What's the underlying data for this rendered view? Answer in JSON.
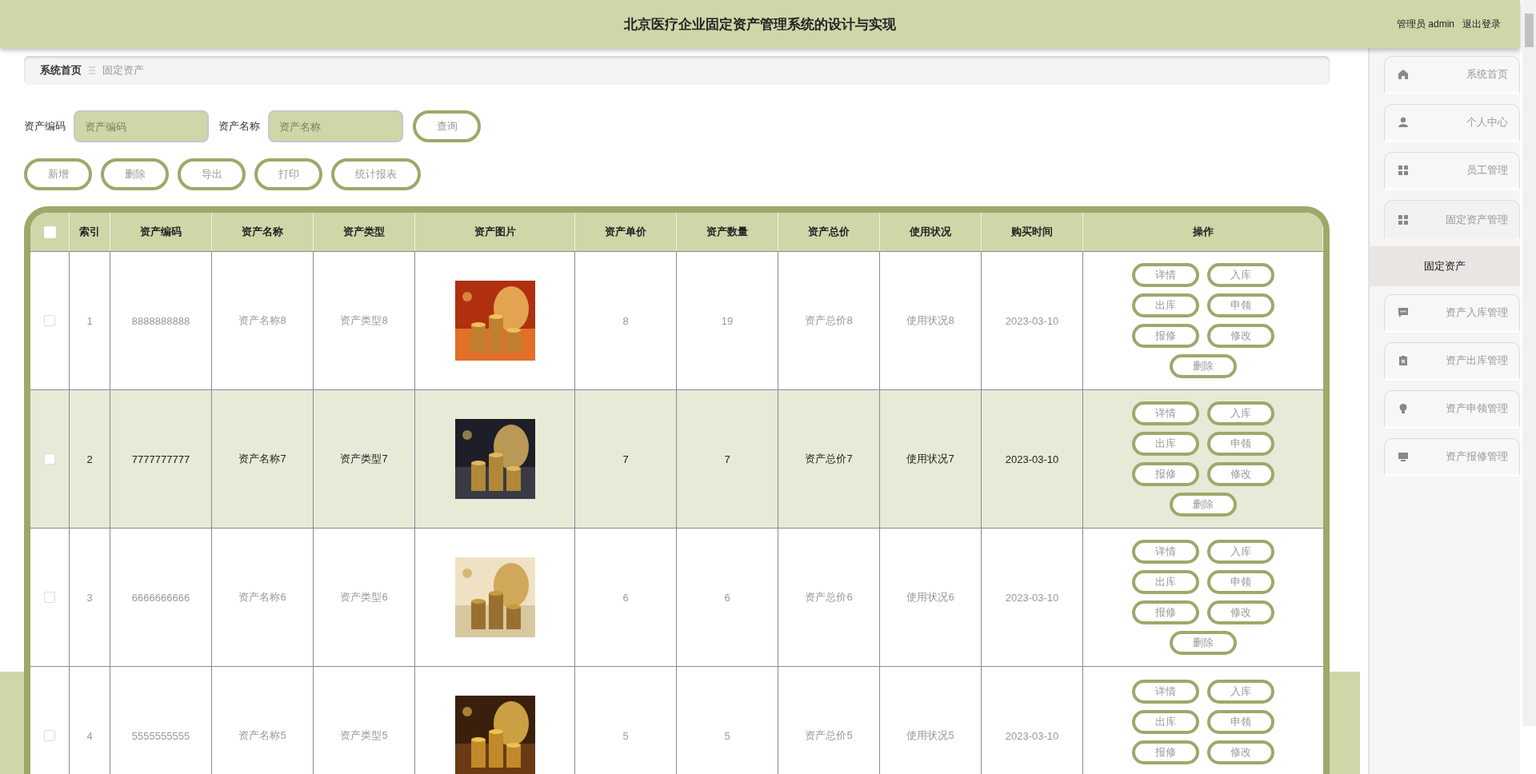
{
  "header": {
    "title": "北京医疗企业固定资产管理系统的设计与实现",
    "user": "管理员 admin",
    "logout": "退出登录"
  },
  "sidebar": {
    "items": [
      {
        "label": "系统首页",
        "selected": false
      },
      {
        "label": "个人中心",
        "selected": false
      },
      {
        "label": "员工管理",
        "selected": false
      },
      {
        "label": "固定资产管理",
        "selected": false,
        "expanded": true,
        "children": [
          {
            "label": "固定资产",
            "selected": true
          }
        ]
      },
      {
        "label": "资产入库管理",
        "selected": false
      },
      {
        "label": "资产出库管理",
        "selected": false
      },
      {
        "label": "资产申领管理",
        "selected": false
      },
      {
        "label": "资产报修管理",
        "selected": false
      }
    ]
  },
  "breadcrumb": [
    "系统首页",
    "固定资产"
  ],
  "search": {
    "fields": [
      {
        "label": "资产编码",
        "placeholder": "资产编码"
      },
      {
        "label": "资产名称",
        "placeholder": "资产名称"
      }
    ],
    "button": "查询"
  },
  "toolbar": [
    "新增",
    "删除",
    "导出",
    "打印",
    "统计报表"
  ],
  "table": {
    "all_checked": false,
    "columns": [
      "索引",
      "资产编码",
      "资产名称",
      "资产类型",
      "资产图片",
      "资产单价",
      "资产数量",
      "资产总价",
      "使用状况",
      "购买时间",
      "操作"
    ],
    "rows": [
      {
        "checked": false,
        "hover": false,
        "index": "1",
        "code": "8888888888",
        "name": "资产名称8",
        "type": "资产类型8",
        "picture": {
          "kind": "picture"
        },
        "price": "8",
        "quantity": "19",
        "total": "资产总价8",
        "status": "使用状况8",
        "date": "2023-03-10",
        "actions": [
          "详情",
          "入库",
          "出库",
          "申领",
          "报修",
          "修改",
          "删除"
        ]
      },
      {
        "checked": false,
        "hover": true,
        "index": "2",
        "code": "7777777777",
        "name": "资产名称7",
        "type": "资产类型7",
        "picture": {
          "kind": "picture"
        },
        "price": "7",
        "quantity": "7",
        "total": "资产总价7",
        "status": "使用状况7",
        "date": "2023-03-10",
        "actions": [
          "详情",
          "入库",
          "出库",
          "申领",
          "报修",
          "修改",
          "删除"
        ]
      },
      {
        "checked": false,
        "hover": false,
        "index": "3",
        "code": "6666666666",
        "name": "资产名称6",
        "type": "资产类型6",
        "picture": {
          "kind": "picture"
        },
        "price": "6",
        "quantity": "6",
        "total": "资产总价6",
        "status": "使用状况6",
        "date": "2023-03-10",
        "actions": [
          "详情",
          "入库",
          "出库",
          "申领",
          "报修",
          "修改",
          "删除"
        ]
      },
      {
        "checked": false,
        "hover": false,
        "index": "4",
        "code": "5555555555",
        "name": "资产名称5",
        "type": "资产类型5",
        "picture": {
          "kind": "picture"
        },
        "price": "5",
        "quantity": "5",
        "total": "资产总价5",
        "status": "使用状况5",
        "date": "2023-03-10",
        "actions": [
          "详情",
          "入库",
          "出库",
          "申领",
          "报修",
          "修改"
        ]
      }
    ]
  }
}
